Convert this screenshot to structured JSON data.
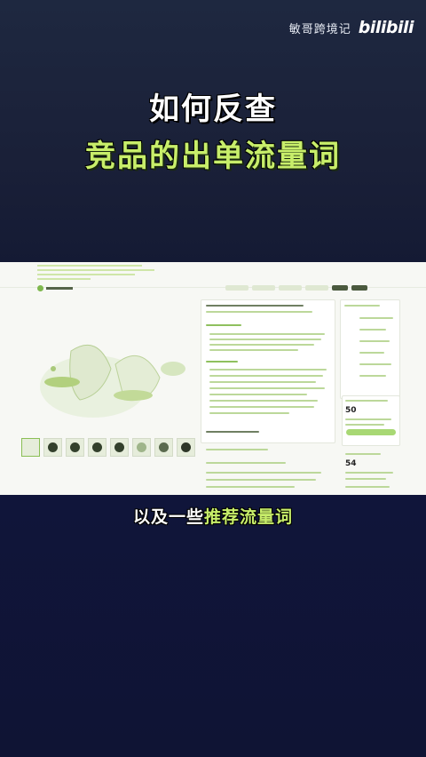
{
  "brand": {
    "channel_name": "敏哥跨境记",
    "logo_text": "bilibili"
  },
  "title": {
    "line1": "如何反查",
    "line2": "竞品的出单流量词"
  },
  "screenshot": {
    "price_a": "50",
    "price_b": "54",
    "colors": {
      "accent": "#a8d874",
      "background": "#f7f8f4"
    }
  },
  "caption": {
    "part1": "以及一些",
    "part2": "推荐流量词"
  },
  "colors": {
    "title_highlight": "#c8ee6a",
    "background": "#141a34"
  }
}
